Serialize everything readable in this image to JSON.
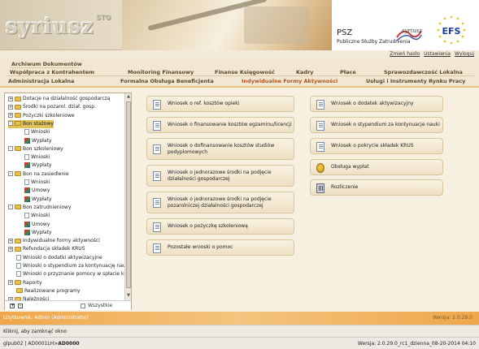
{
  "header": {
    "logo": "syriusz",
    "logo_suffix": "STO",
    "psz_title": "PSZ",
    "psz_subtitle": "Publiczne Służby Zatrudnienia",
    "efs_logo": "EFS"
  },
  "user_links": [
    "Zmień hasło",
    "Ustawienia",
    "Wyloguj"
  ],
  "tabs": {
    "row1": [
      "Archiwum Dokumentów"
    ],
    "row2": [
      "Współpraca z Kontrahentem",
      "Monitoring Finansowy",
      "Finanse Księgowość",
      "Kadry",
      "Płace",
      "Sprawozdawczość Lokalna"
    ],
    "row3": [
      "Administracja Lokalna",
      "Formalna Obsługa Beneficjenta",
      "Indywidualne Formy Aktywności",
      "Usługi i Instrumenty Rynku Pracy"
    ],
    "active": "Indywidualne Formy Aktywności"
  },
  "tree": [
    {
      "label": "Dotacje na działalność gospodarczą",
      "level": 0,
      "type": "folder",
      "toggle": "+"
    },
    {
      "label": "Środki na pozarol. dział. gosp.",
      "level": 0,
      "type": "folder",
      "toggle": "+"
    },
    {
      "label": "Pożyczki szkoleniowe",
      "level": 0,
      "type": "folder",
      "toggle": "+"
    },
    {
      "label": "Bon stażowy",
      "level": 0,
      "type": "folder",
      "toggle": "-",
      "selected": true
    },
    {
      "label": "Wnioski",
      "level": 2,
      "type": "doc"
    },
    {
      "label": "Wypłaty",
      "level": 2,
      "type": "pen"
    },
    {
      "label": "Bon szkoleniowy",
      "level": 0,
      "type": "folder",
      "toggle": "-"
    },
    {
      "label": "Wnioski",
      "level": 2,
      "type": "doc"
    },
    {
      "label": "Wypłaty",
      "level": 2,
      "type": "pen"
    },
    {
      "label": "Bon na zasiedlenie",
      "level": 0,
      "type": "folder",
      "toggle": "-"
    },
    {
      "label": "Wnioski",
      "level": 2,
      "type": "doc"
    },
    {
      "label": "Umowy",
      "level": 2,
      "type": "pen"
    },
    {
      "label": "Wypłaty",
      "level": 2,
      "type": "pen"
    },
    {
      "label": "Bon zatrudnieniowy",
      "level": 0,
      "type": "folder",
      "toggle": "-"
    },
    {
      "label": "Wnioski",
      "level": 2,
      "type": "doc"
    },
    {
      "label": "Umowy",
      "level": 2,
      "type": "pen"
    },
    {
      "label": "Wypłaty",
      "level": 2,
      "type": "pen"
    },
    {
      "label": "Indywidualne formy aktywności",
      "level": 0,
      "type": "folder",
      "toggle": "+"
    },
    {
      "label": "Refundacja składek KRUS",
      "level": 0,
      "type": "folder",
      "toggle": "+"
    },
    {
      "label": "Wnioski o dodatki aktywizacyjne",
      "level": 1,
      "type": "doc"
    },
    {
      "label": "Wnioski o stypendium za kontynuację nau",
      "level": 1,
      "type": "doc"
    },
    {
      "label": "Wnioski o przyznanie pomocy w spłacie kr",
      "level": 1,
      "type": "doc"
    },
    {
      "label": "Raporty",
      "level": 0,
      "type": "folder",
      "toggle": "+"
    },
    {
      "label": "Realizowane programy",
      "level": 1,
      "type": "folder"
    },
    {
      "label": "Należności",
      "level": 0,
      "type": "folder",
      "toggle": "+"
    }
  ],
  "tree_controls": {
    "expand": "+",
    "collapse": "-",
    "all_label": "Wszystkie"
  },
  "cards_left": [
    "Wniosek o ref. kosztów opieki",
    "Wniosek o finansowanie kosztów egzaminu/licencji",
    "Wniosek o dofinansowanie kosztów studiów podyplomowych",
    "Wniosek o jednorazowe środki na podjęcie działalności gospodarczej",
    "Wniosek o jednorazowe środki na podjęcie pozarolniczej działalności gospodarczej",
    "Wniosek o pożyczkę szkoleniową",
    "Pozostałe wnioski o pomoc"
  ],
  "cards_right": [
    "Wniosek o dodatek aktywizacyjny",
    "Wniosek o stypendium za kontynuacje nauki",
    "Wniosek o pokrycie składek KRUS",
    "Obsługa wypłat",
    "Rozliczenie"
  ],
  "footer": {
    "user": "Użytkownik: Admin (Administrator)",
    "version": "Wersja: 2.0.29.0"
  },
  "status": {
    "hint": "Kliknij, aby zamknąć okno",
    "left_prefix": "glpub02 | AD0001LH>",
    "left_bold": "AD0000",
    "right": "Wersja: 2.0.29.0_rc1_dzienna_08-20-2014 04:10"
  }
}
